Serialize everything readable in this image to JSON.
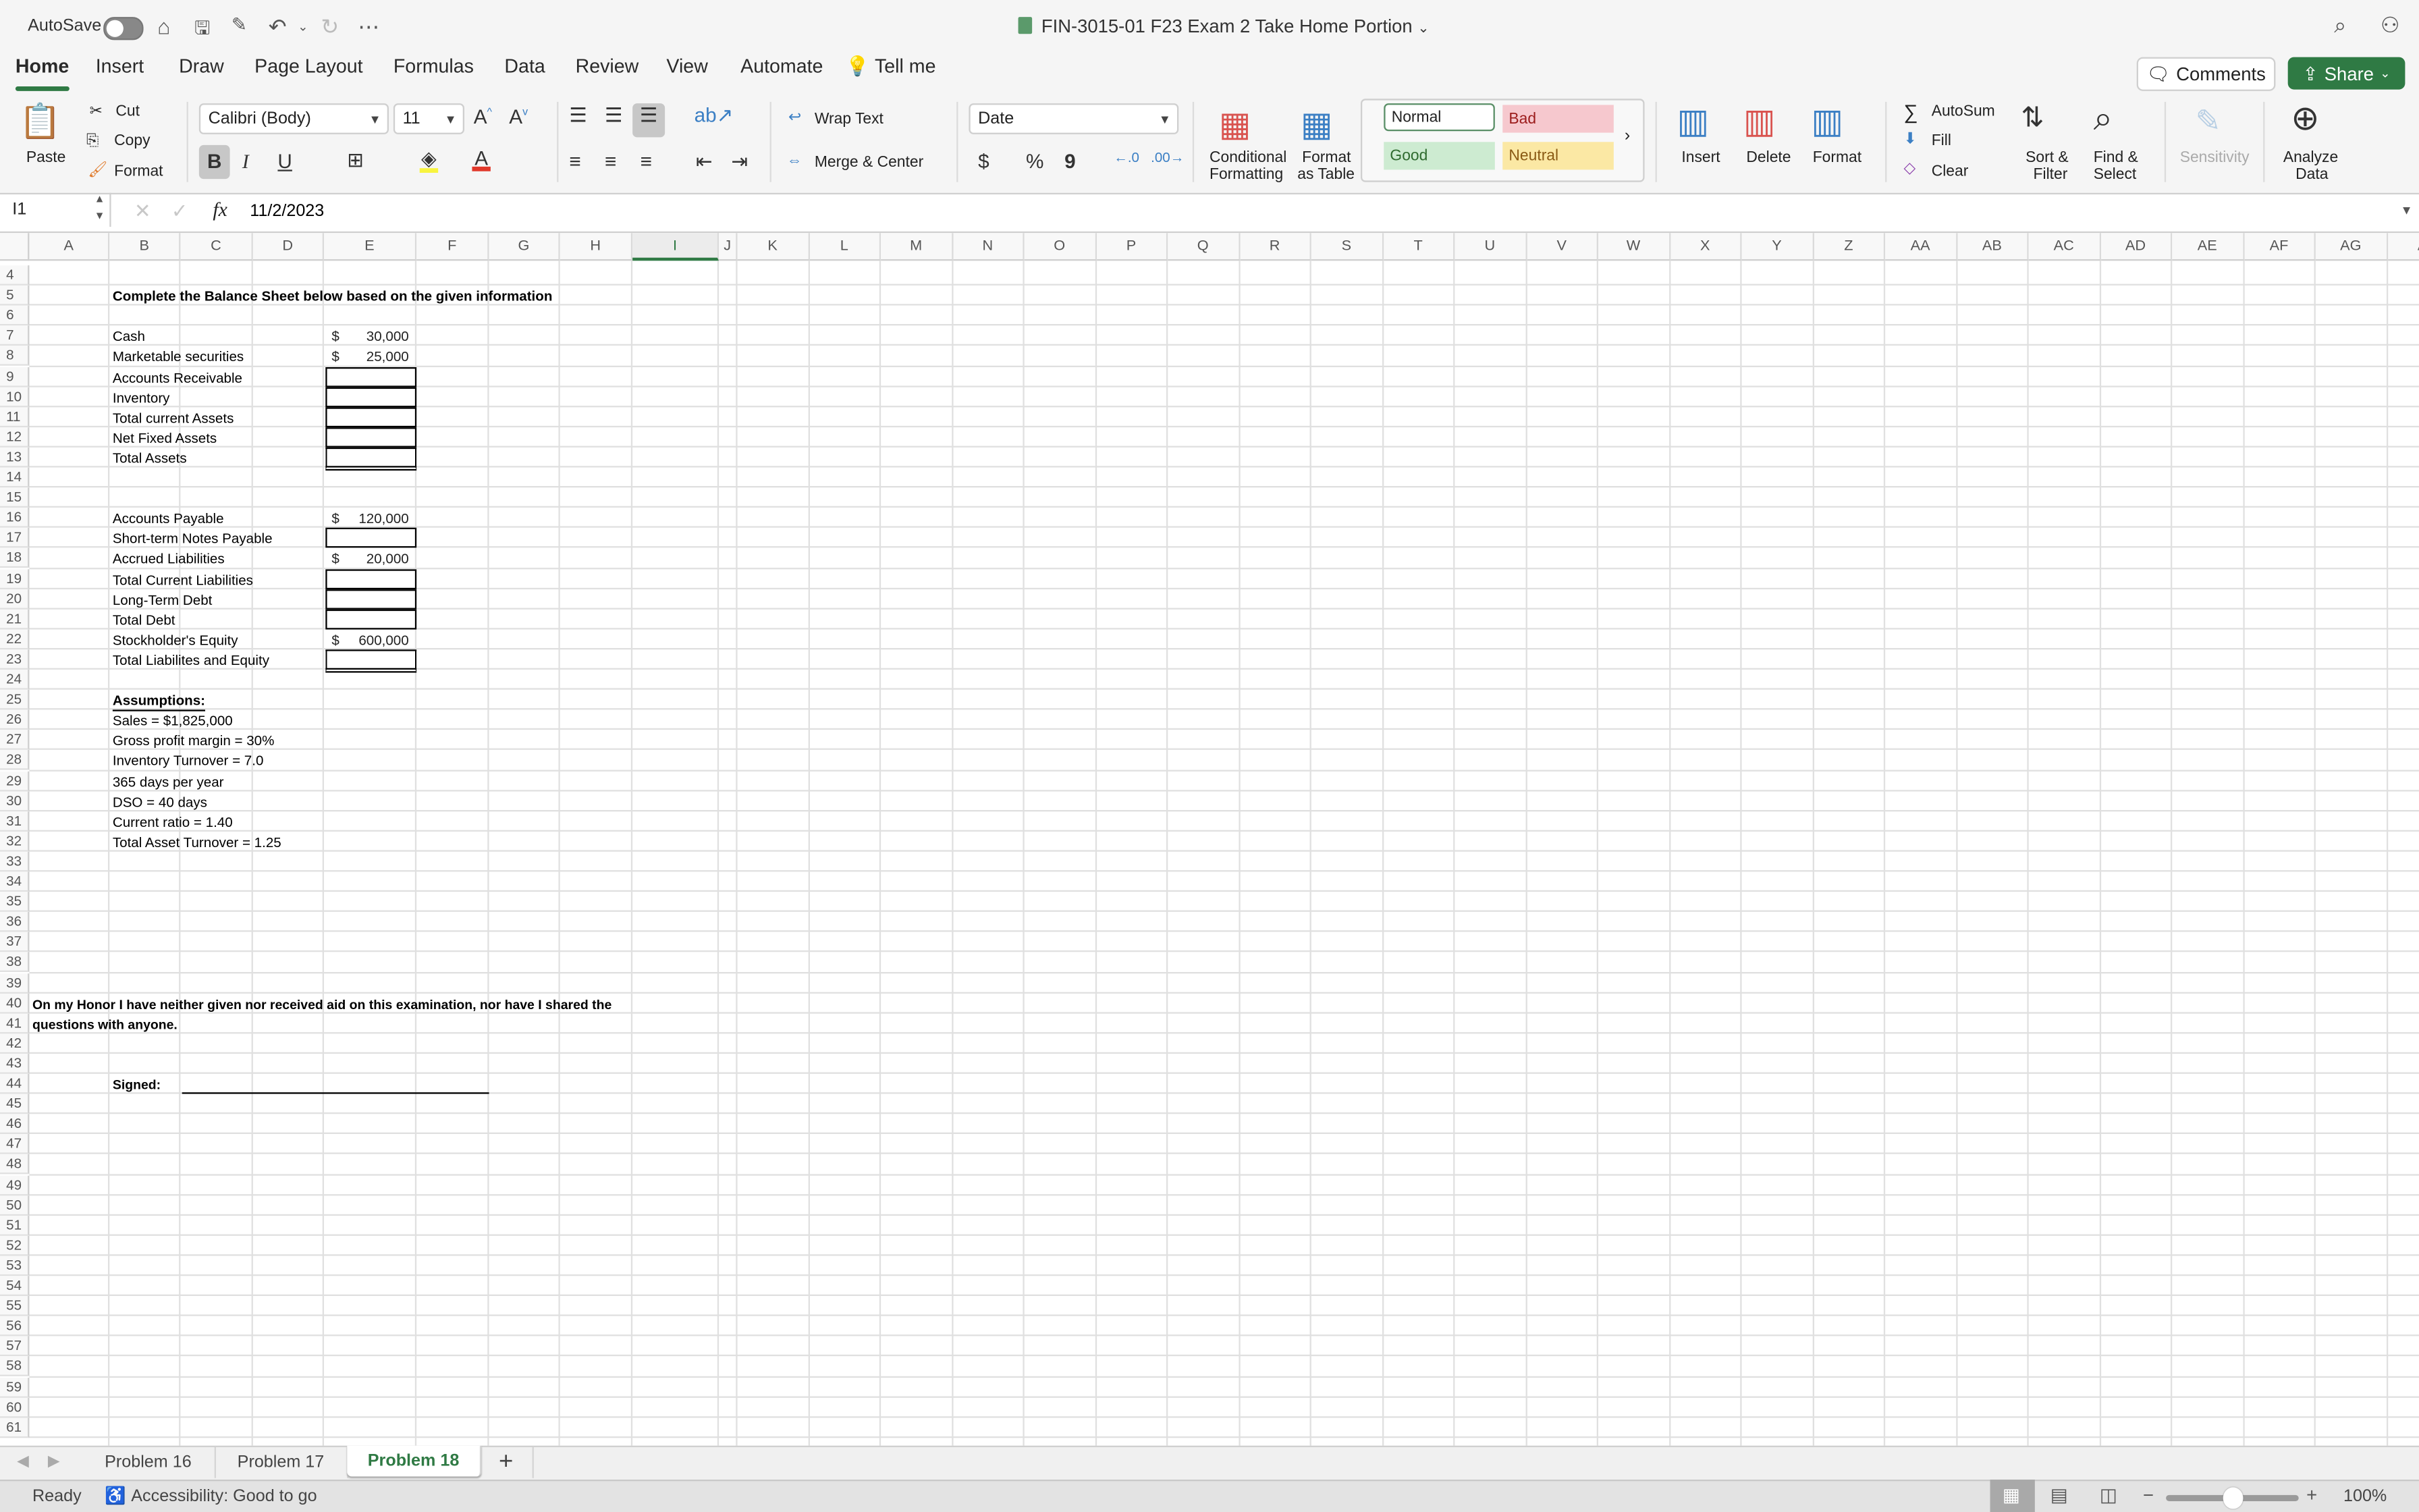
{
  "titlebar": {
    "autosave_label": "AutoSave",
    "autosave_on": false,
    "document_title": "FIN-3015-01 F23 Exam 2 Take Home Portion",
    "icons": [
      "home-icon",
      "save-icon",
      "save-as-icon",
      "undo-icon",
      "redo-icon",
      "more-icon",
      "search-icon",
      "share-people-icon"
    ]
  },
  "menu_tabs": [
    {
      "label": "Home",
      "active": true
    },
    {
      "label": "Insert"
    },
    {
      "label": "Draw"
    },
    {
      "label": "Page Layout"
    },
    {
      "label": "Formulas"
    },
    {
      "label": "Data"
    },
    {
      "label": "Review"
    },
    {
      "label": "View"
    },
    {
      "label": "Automate"
    }
  ],
  "tell_me": "Tell me",
  "comments_label": "Comments",
  "share_label": "Share",
  "ribbon": {
    "paste": "Paste",
    "cut": "Cut",
    "copy": "Copy",
    "format_painter": "Format",
    "font_name": "Calibri (Body)",
    "font_size": "11",
    "bold": "B",
    "italic": "I",
    "underline": "U",
    "wrap_text": "Wrap Text",
    "merge_center": "Merge & Center",
    "number_format": "Date",
    "currency": "$",
    "percent": "%",
    "comma": "9",
    "conditional_formatting": [
      "Conditional",
      "Formatting"
    ],
    "format_as_table": [
      "Format",
      "as Table"
    ],
    "styles": {
      "normal": "Normal",
      "bad": "Bad",
      "good": "Good",
      "neutral": "Neutral"
    },
    "insert": "Insert",
    "delete": "Delete",
    "format": "Format",
    "autosum": "AutoSum",
    "fill": "Fill",
    "clear": "Clear",
    "sort_filter": [
      "Sort &",
      "Filter"
    ],
    "find_select": [
      "Find &",
      "Select"
    ],
    "sensitivity": "Sensitivity",
    "analyze_data": [
      "Analyze",
      "Data"
    ]
  },
  "formula_bar": {
    "name_box": "I1",
    "formula": "11/2/2023"
  },
  "columns": [
    "A",
    "B",
    "C",
    "D",
    "E",
    "F",
    "G",
    "H",
    "I",
    "J",
    "K",
    "L",
    "M",
    "N",
    "O",
    "P",
    "Q",
    "R",
    "S",
    "T",
    "U",
    "V",
    "W",
    "X",
    "Y",
    "Z",
    "AA",
    "AB",
    "AC",
    "AD",
    "AE",
    "AF",
    "AG",
    "A"
  ],
  "selected_column": "I",
  "first_row": 4,
  "last_row": 61,
  "sheet": {
    "title": "Complete the Balance Sheet below based on the given information",
    "assets": [
      {
        "row": 7,
        "label": "Cash",
        "value": "30,000"
      },
      {
        "row": 8,
        "label": "Marketable securities",
        "value": "25,000"
      },
      {
        "row": 9,
        "label": "Accounts Receivable",
        "value": null
      },
      {
        "row": 10,
        "label": "Inventory",
        "value": null
      },
      {
        "row": 11,
        "label": "Total current Assets",
        "value": null
      },
      {
        "row": 12,
        "label": "Net Fixed Assets",
        "value": null
      },
      {
        "row": 13,
        "label": "Total Assets",
        "value": null
      }
    ],
    "liabilities": [
      {
        "row": 16,
        "label": "Accounts Payable",
        "value": "120,000"
      },
      {
        "row": 17,
        "label": "Short-term Notes Payable",
        "value": null
      },
      {
        "row": 18,
        "label": "Accrued Liabilities",
        "value": "20,000"
      },
      {
        "row": 19,
        "label": "Total Current Liabilities",
        "value": null
      },
      {
        "row": 20,
        "label": "Long-Term Debt",
        "value": null
      },
      {
        "row": 21,
        "label": "Total Debt",
        "value": null
      },
      {
        "row": 22,
        "label": "Stockholder's Equity",
        "value": "600,000"
      },
      {
        "row": 23,
        "label": "Total Liabilites and Equity",
        "value": null
      }
    ],
    "currency_symbol": "$",
    "assumptions_heading": "Assumptions:",
    "assumptions": [
      "Sales = $1,825,000",
      "Gross profit margin = 30%",
      "Inventory Turnover = 7.0",
      "365 days per year",
      "DSO = 40 days",
      "Current ratio = 1.40",
      "Total Asset Turnover = 1.25"
    ],
    "honor_line1": "On my Honor I have neither given nor received aid on this examination, nor have I shared the",
    "honor_line2": "questions with anyone.",
    "signed_label": "Signed:"
  },
  "sheet_tabs": [
    {
      "label": "Problem 16"
    },
    {
      "label": "Problem 17"
    },
    {
      "label": "Problem 18",
      "active": true
    }
  ],
  "status": {
    "ready": "Ready",
    "accessibility": "Accessibility: Good to go",
    "zoom": "100%",
    "zoom_fraction": 0.5
  }
}
